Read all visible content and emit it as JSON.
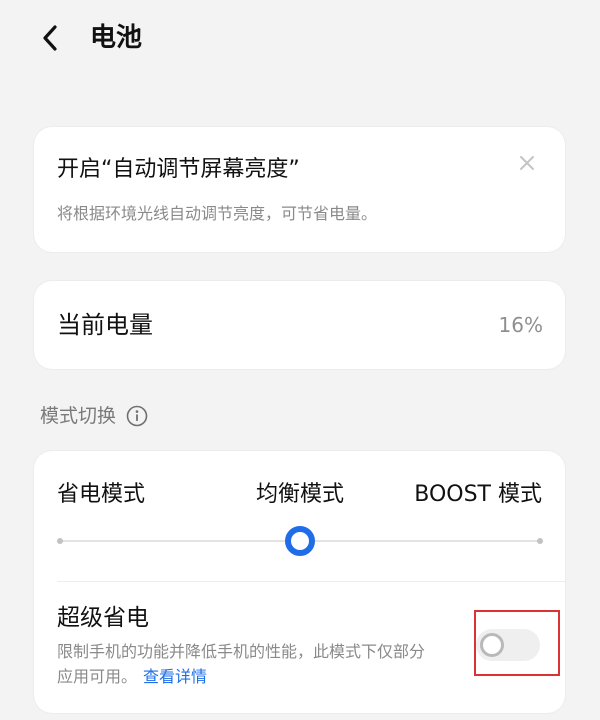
{
  "header": {
    "title": "电池",
    "back_icon": "chevron-left-icon"
  },
  "tip": {
    "title": "开启“自动调节屏幕亮度”",
    "description": "将根据环境光线自动调节亮度，可节省电量。",
    "close_icon": "close-icon"
  },
  "battery": {
    "label": "当前电量",
    "value": "16%"
  },
  "mode_section": {
    "label": "模式切换",
    "info_icon": "info-icon",
    "modes": [
      "省电模式",
      "均衡模式",
      "BOOST 模式"
    ],
    "selected_mode": "均衡模式",
    "slider_position": 0.5
  },
  "super_saver": {
    "title": "超级省电",
    "description": "限制手机的功能并降低手机的性能，此模式下仅部分应用可用。",
    "link": "查看详情",
    "enabled": false
  },
  "colors": {
    "accent": "#1f6ee8",
    "highlight": "#d93333",
    "background": "#f3f3f3"
  }
}
